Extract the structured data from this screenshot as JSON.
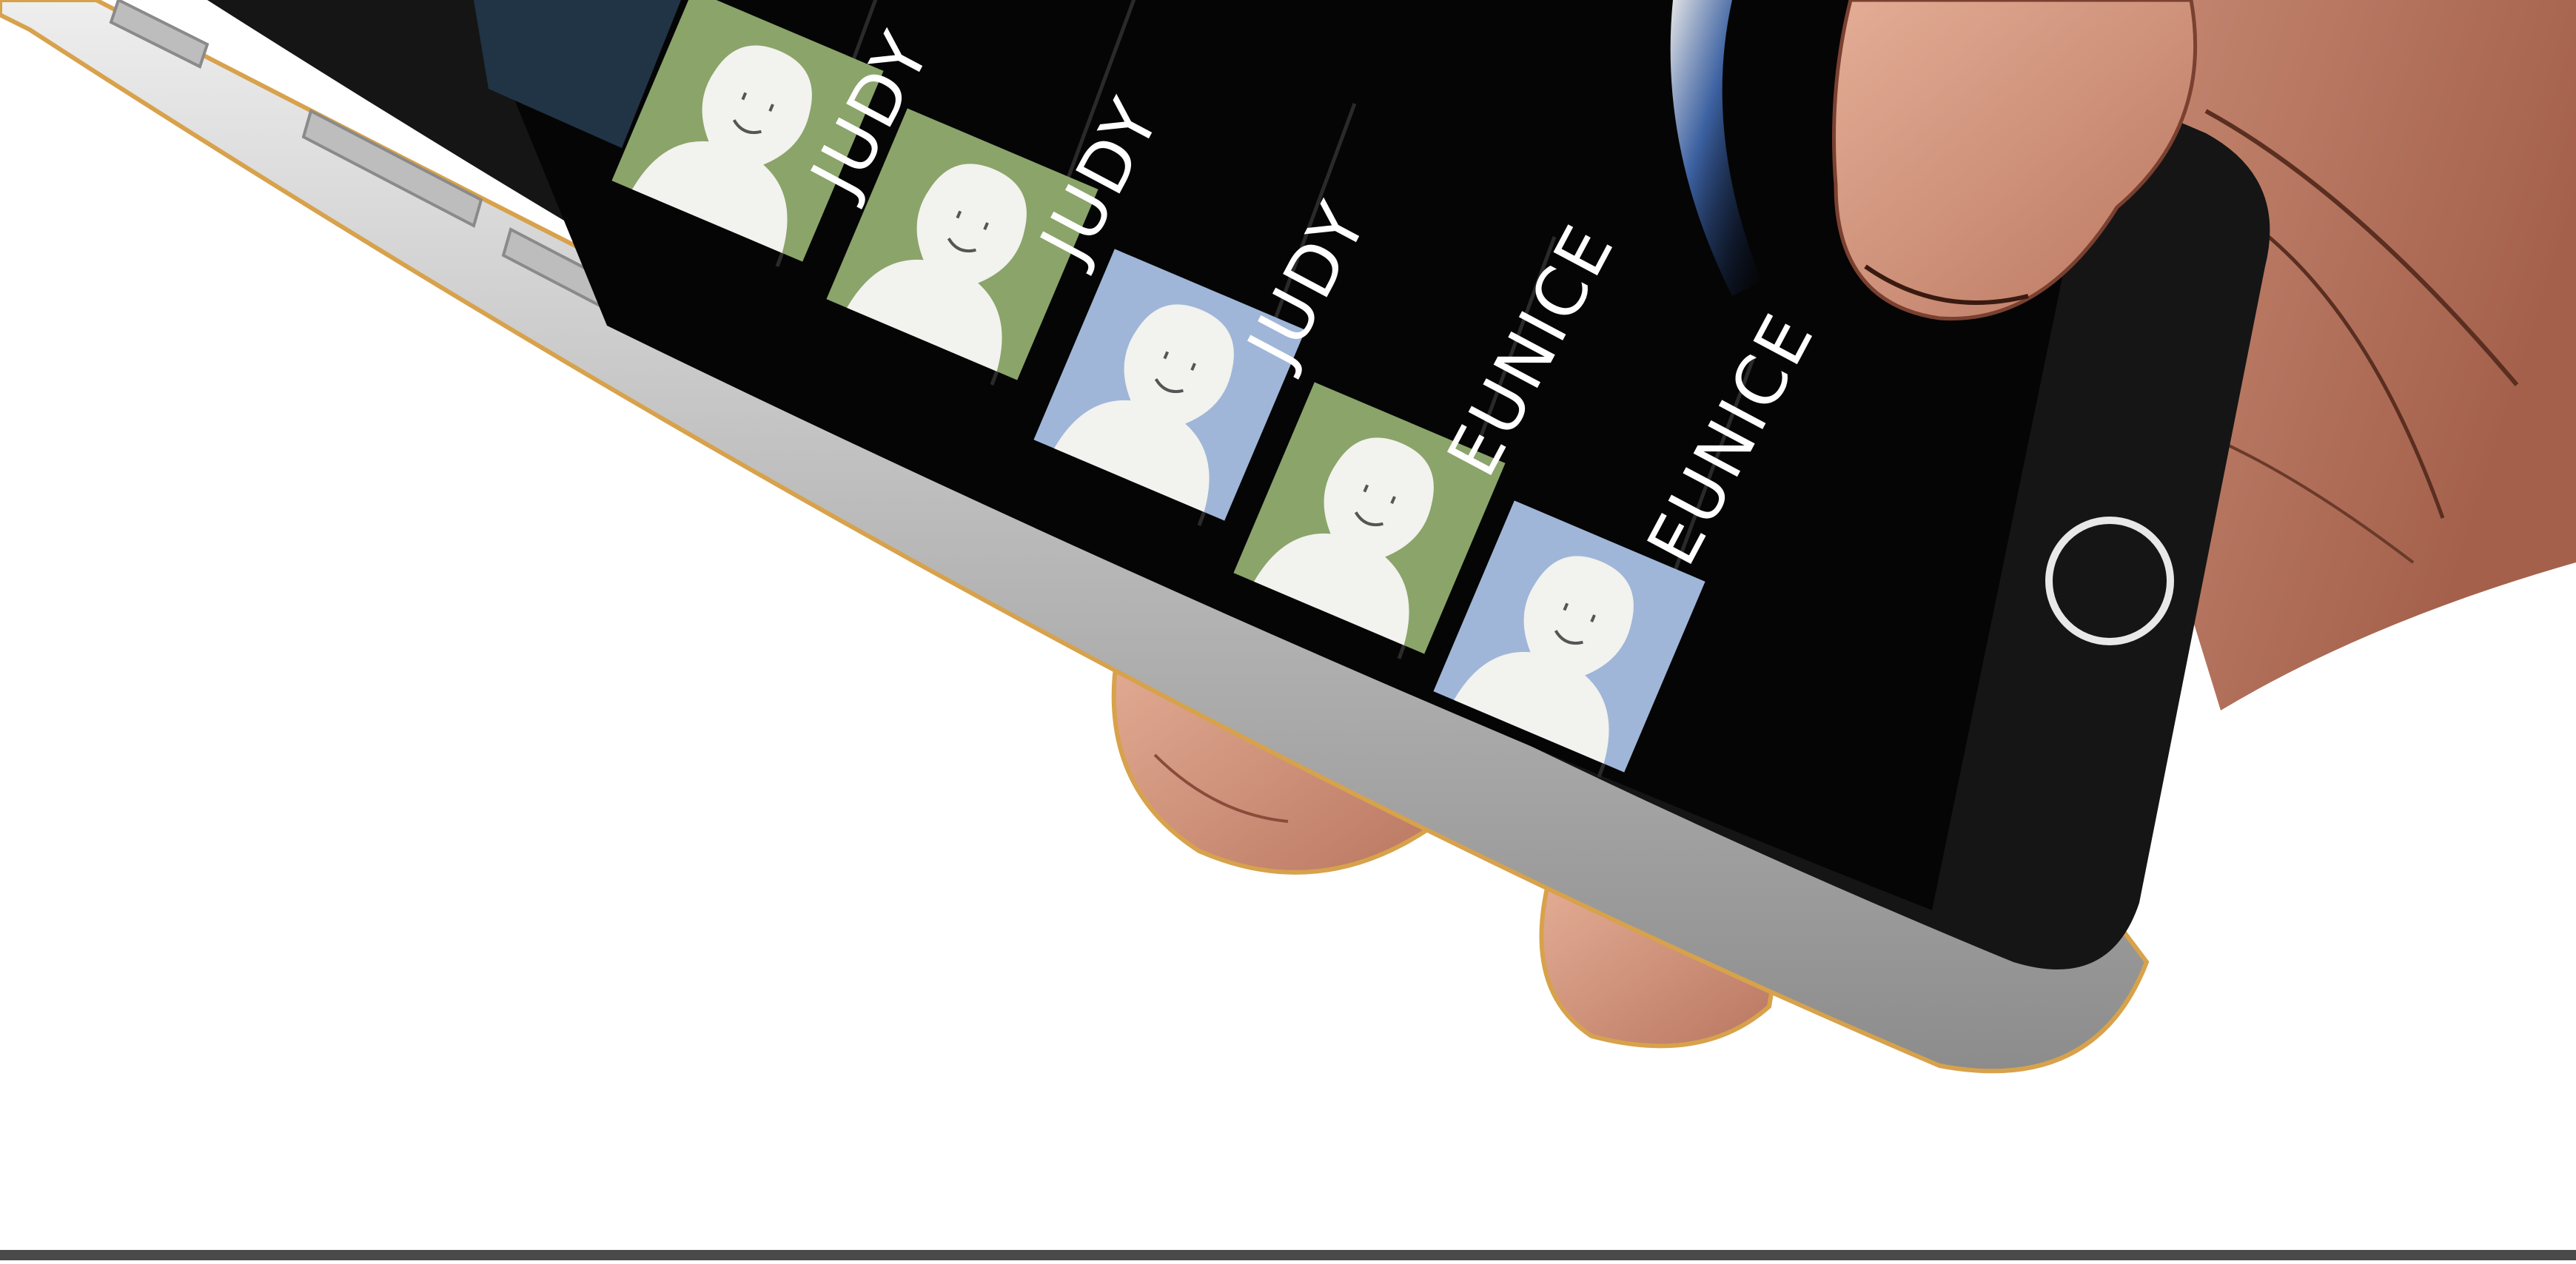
{
  "contacts": [
    {
      "name": "JUDY",
      "avatar": "green"
    },
    {
      "name": "JUDY",
      "avatar": "green"
    },
    {
      "name": "JUDY",
      "avatar": "blue"
    },
    {
      "name": "EUNICE",
      "avatar": "green"
    },
    {
      "name": "EUNICE",
      "avatar": "blue"
    }
  ],
  "colors": {
    "avatar_green": "#8aa46a",
    "avatar_blue": "#9fb6d8",
    "screen": "#050505",
    "phone_body": "#151515",
    "aluminum": "#c9c9c9",
    "skin": "#d49a82",
    "skin_dark": "#b8775f",
    "outline": "#d7a24b"
  },
  "icons": [
    "person-silhouette-icon",
    "home-button-icon"
  ]
}
